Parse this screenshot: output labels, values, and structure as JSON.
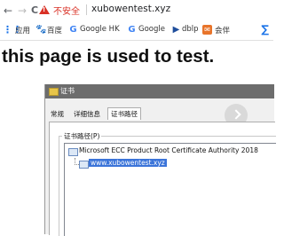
{
  "browser": {
    "nav": {
      "back": "←",
      "forward": "→",
      "reload": "C"
    },
    "security_label": "不安全",
    "url": "xubowentest.xyz",
    "bookmarks": [
      {
        "label": "应用",
        "icon": "apps-grid-icon",
        "color": "#1a73e8"
      },
      {
        "label": "百度",
        "icon": "baidu-paw-icon",
        "color": "#2932e1"
      },
      {
        "label": "Google HK",
        "icon": "google-g-icon",
        "color": "#4285f4"
      },
      {
        "label": "Google",
        "icon": "google-g-icon",
        "color": "#4285f4"
      },
      {
        "label": "dblp",
        "icon": "dblp-icon",
        "color": "#1f4e9c"
      },
      {
        "label": "会伴",
        "icon": "huiban-icon",
        "color": "#e8742a"
      }
    ]
  },
  "page": {
    "heading": "this page is used to test."
  },
  "dialog": {
    "title": "证书",
    "tabs": [
      "常规",
      "详细信息",
      "证书路径"
    ],
    "active_tab": "证书路径",
    "group_label": "证书路径(P)",
    "tree": [
      {
        "label": "Microsoft ECC Product Root Certificate Authority 2018",
        "selected": false
      },
      {
        "label": "www.xubowentest.xyz",
        "selected": true
      }
    ]
  },
  "colors": {
    "warning": "#d93025",
    "selection": "#3b74d9",
    "titlebar": "#6d6d6d"
  }
}
